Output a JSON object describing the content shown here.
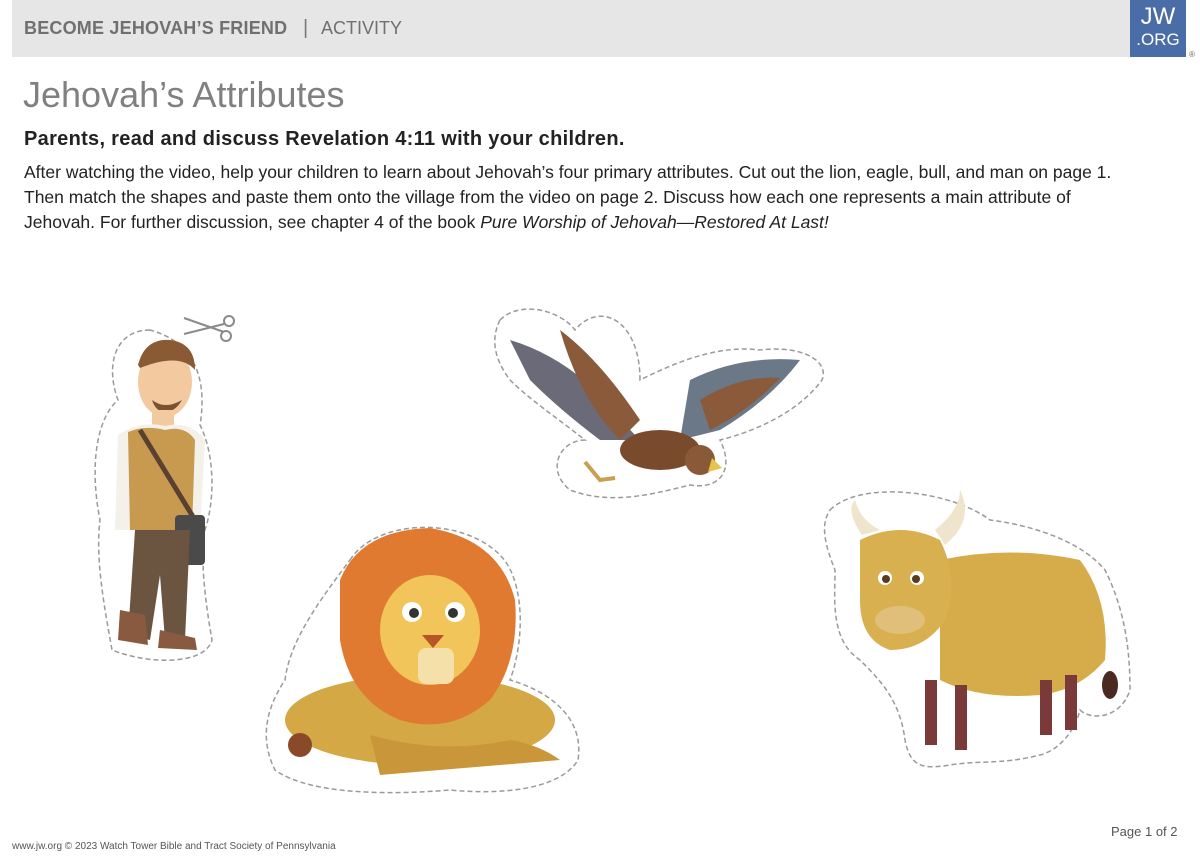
{
  "header": {
    "series": "BECOME JEHOVAH’S FRIEND",
    "separator": "|",
    "type": "ACTIVITY"
  },
  "logo": {
    "top": "JW",
    "bottom": ".ORG",
    "registered": "®"
  },
  "title": "Jehovah’s Attributes",
  "subtitle": "Parents, read and discuss Revelation 4:11 with your children.",
  "body": {
    "text": "After watching the video, help your children to learn about Jehovah’s four primary attributes. Cut out the lion, eagle, bull, and man on page 1. Then match the shapes and paste them onto the village from the video on page 2. Discuss how each one represents a main attribute of Jehovah. For further discussion, see chapter 4 of the book ",
    "book_title": "Pure Worship of Jehovah—Restored At Last!"
  },
  "footer": {
    "copyright": "www.jw.org © 2023 Watch Tower Bible and Tract Society of Pennsylvania",
    "page": "Page 1 of 2"
  },
  "colors": {
    "header_bg": "#e6e6e6",
    "logo_bg": "#4a6da7",
    "title": "#808080"
  },
  "icons": [
    "scissors-icon"
  ]
}
